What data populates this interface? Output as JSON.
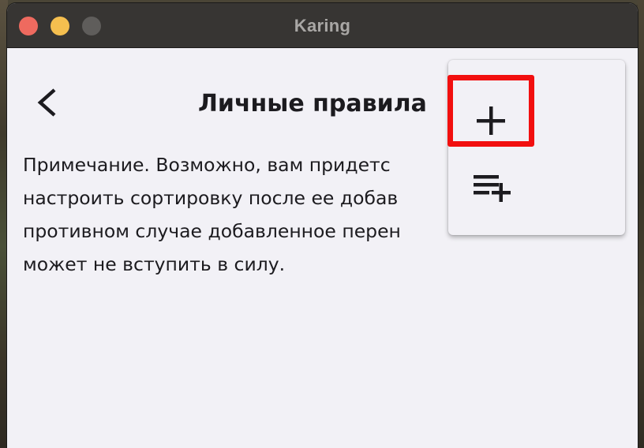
{
  "window": {
    "title": "Karing",
    "traffic_lights": [
      "close",
      "minimize",
      "maximize"
    ]
  },
  "header": {
    "back_icon": "chevron-left-icon",
    "title": "Личные правила"
  },
  "main": {
    "note_lines": [
      "Примечание. Возможно, вам придетс",
      "настроить сортировку после ее добав",
      "противном случае добавленное перен",
      "может не вступить в силу."
    ]
  },
  "popup_menu": {
    "items": [
      {
        "icon": "add-icon",
        "highlighted": true
      },
      {
        "icon": "playlist-add-icon",
        "highlighted": false
      }
    ]
  },
  "colors": {
    "titlebar": "#373533",
    "background": "#f2f1f6",
    "highlight": "#f20f0f",
    "text": "#1c1b1f",
    "close": "#ee6a5f",
    "minimize": "#f5bf4f",
    "maximize": "#5f5d5b"
  }
}
